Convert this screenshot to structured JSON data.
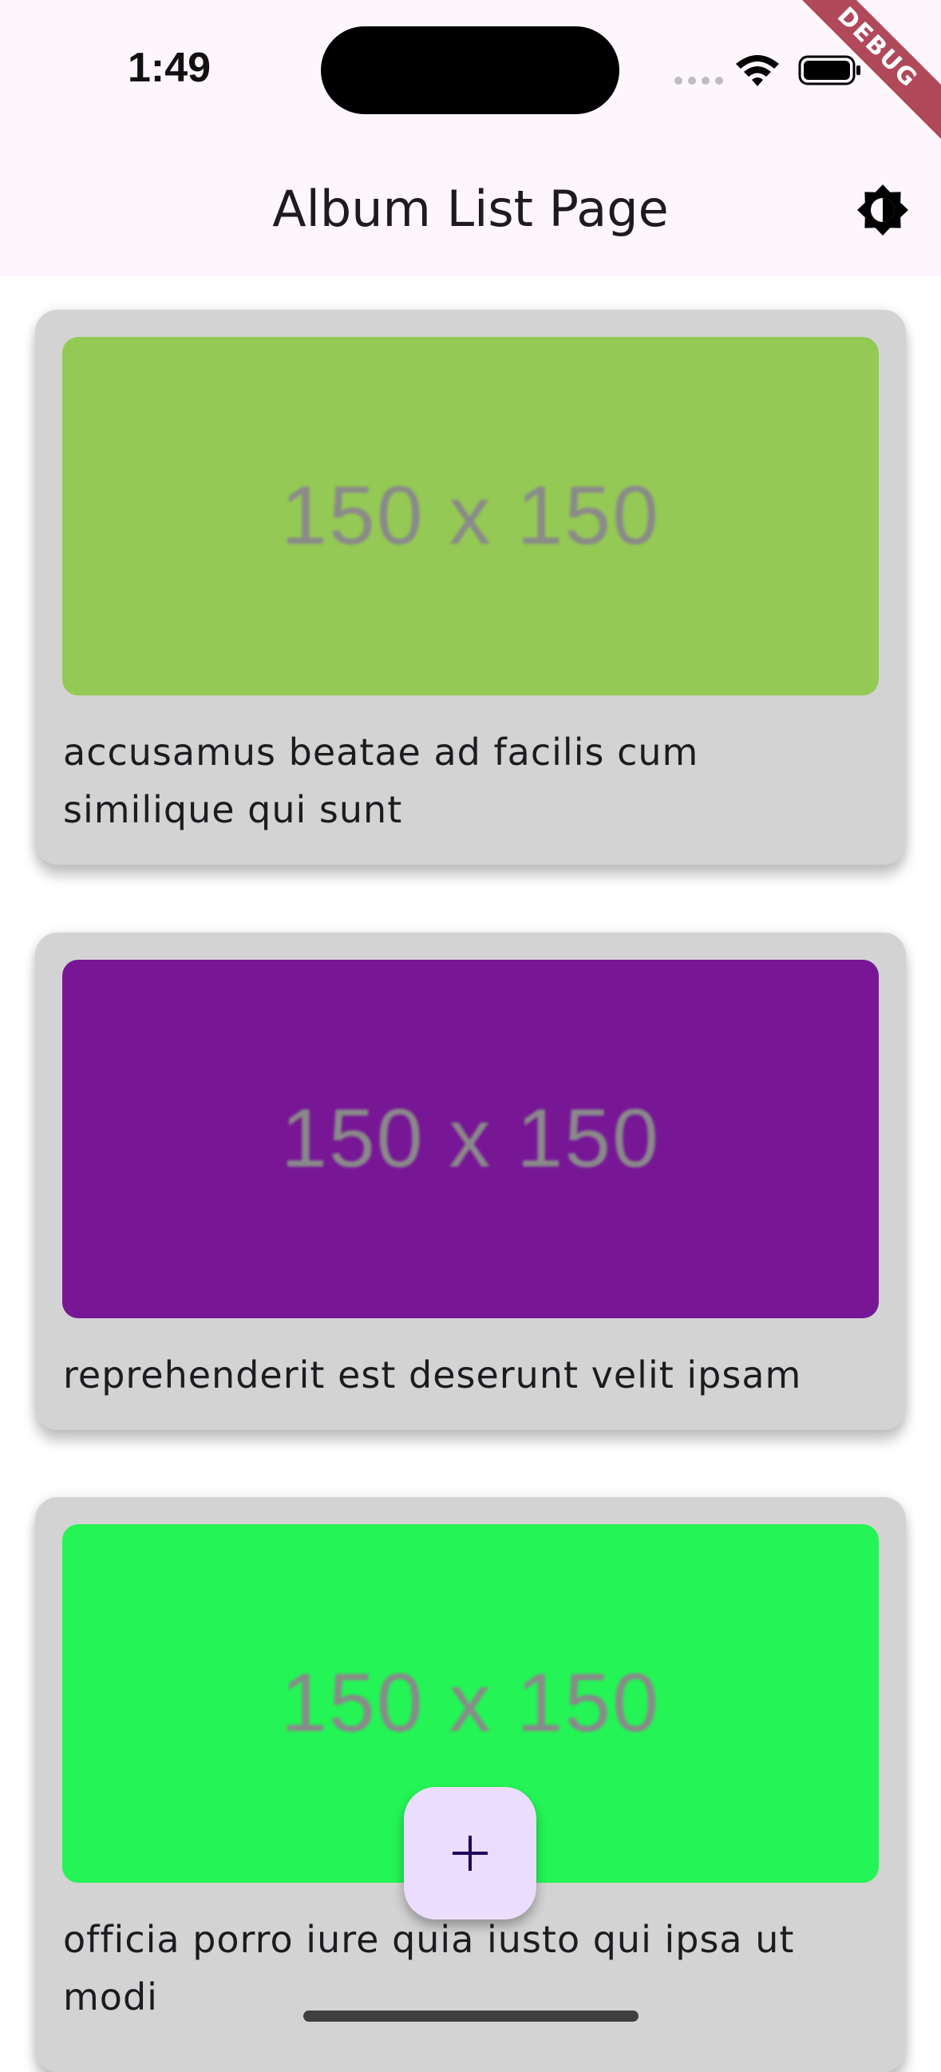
{
  "status_bar": {
    "time": "1:49",
    "debug_label": "DEBUG"
  },
  "app_bar": {
    "title": "Album List Page",
    "theme_icon": "brightness-contrast-icon"
  },
  "albums": [
    {
      "thumbnail_text": "150 x 150",
      "thumbnail_color": "#95c955",
      "title": "accusamus beatae ad facilis cum similique qui sunt"
    },
    {
      "thumbnail_text": "150 x 150",
      "thumbnail_color": "#771796",
      "title": "reprehenderit est deserunt velit ipsam"
    },
    {
      "thumbnail_text": "150 x 150",
      "thumbnail_color": "#24f456",
      "title": "officia porro iure quia iusto qui ipsa ut modi"
    }
  ],
  "fab": {
    "icon": "plus-icon"
  }
}
